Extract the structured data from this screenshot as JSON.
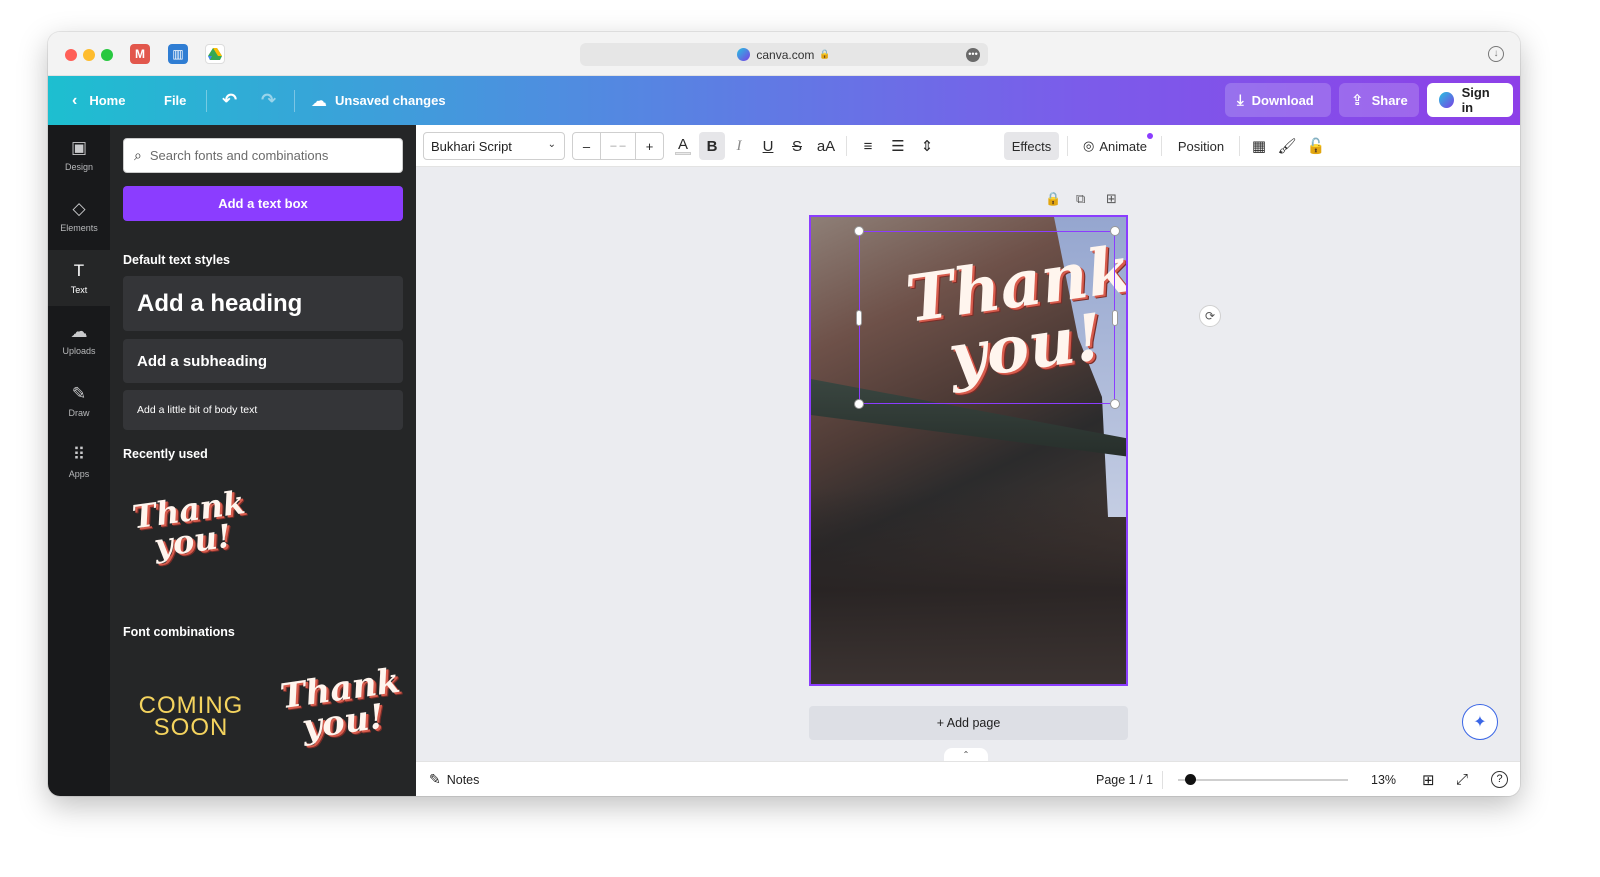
{
  "browser": {
    "url": "canva.com",
    "favicons": [
      "mail-icon",
      "trello-icon",
      "drive-icon"
    ]
  },
  "header": {
    "home_label": "Home",
    "file_label": "File",
    "status_label": "Unsaved changes",
    "download_label": "Download",
    "share_label": "Share",
    "signin_label": "Sign in"
  },
  "rail": {
    "items": [
      {
        "label": "Design",
        "icon": "design-icon"
      },
      {
        "label": "Elements",
        "icon": "elements-icon"
      },
      {
        "label": "Text",
        "icon": "text-icon"
      },
      {
        "label": "Uploads",
        "icon": "upload-icon"
      },
      {
        "label": "Draw",
        "icon": "draw-icon"
      },
      {
        "label": "Apps",
        "icon": "apps-icon"
      }
    ],
    "active": "Text"
  },
  "panel": {
    "search_placeholder": "Search fonts and combinations",
    "add_textbox_label": "Add a text box",
    "default_styles_title": "Default text styles",
    "heading_label": "Add a heading",
    "subheading_label": "Add a subheading",
    "body_label": "Add a little bit of body text",
    "recently_used_title": "Recently used",
    "recent_item_line1": "Thank",
    "recent_item_line2": "you!",
    "font_combinations_title": "Font combinations",
    "combo1_line1": "COMING",
    "combo1_line2": "SOON",
    "combo2_line1": "Thank",
    "combo2_line2": "you!"
  },
  "toolbar": {
    "font_name": "Bukhari Script",
    "font_size": "– –",
    "minus_label": "–",
    "plus_label": "+",
    "color_label": "A",
    "bold_label": "B",
    "italic_label": "I",
    "underline_label": "U",
    "strike_label": "S",
    "case_label": "aA",
    "effects_label": "Effects",
    "animate_label": "Animate",
    "position_label": "Position"
  },
  "canvas": {
    "text_line1": "Thank",
    "text_line2": "you!",
    "add_page_label": "+ Add page"
  },
  "footer": {
    "notes_label": "Notes",
    "page_indicator": "Page 1 / 1",
    "zoom_level": "13%",
    "zoom_fraction": 0.04
  },
  "colors": {
    "accent": "#8b3dff",
    "header_gradient_start": "#1dbfd0",
    "header_gradient_end": "#8d3fe8",
    "panel_bg": "#252627",
    "rail_bg": "#18191b",
    "canvas_bg": "#ebecf0"
  }
}
